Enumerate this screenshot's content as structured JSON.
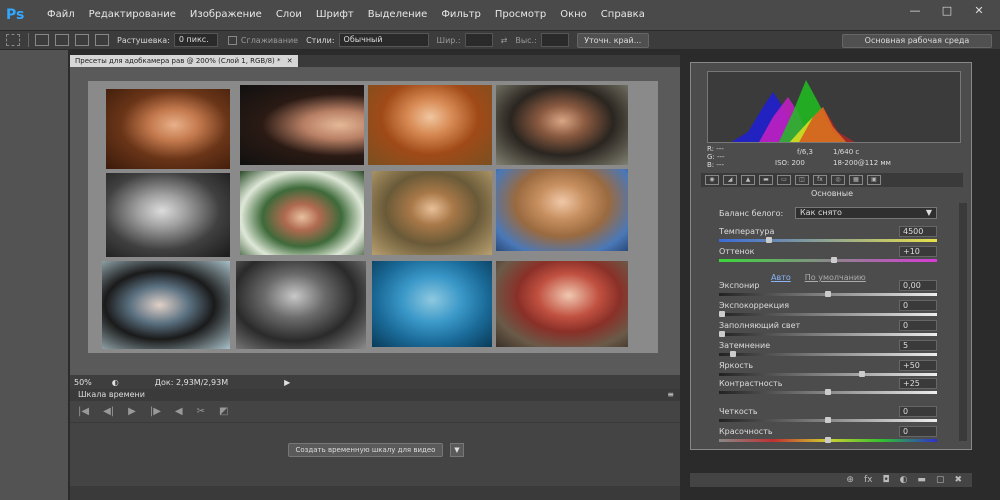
{
  "app_logo": "Ps",
  "menu": [
    "Файл",
    "Редактирование",
    "Изображение",
    "Слои",
    "Шрифт",
    "Выделение",
    "Фильтр",
    "Просмотр",
    "Окно",
    "Справка"
  ],
  "window_controls": [
    "—",
    "□",
    "✕"
  ],
  "options": {
    "feather_label": "Растушевка:",
    "feather_value": "0 пикс.",
    "antialias_label": "Сглаживание",
    "style_label": "Стили:",
    "style_value": "Обычный",
    "width_label": "Шир.:",
    "height_label": "Выс.:",
    "refine_btn": "Уточн. край...",
    "workspace": "Основная рабочая среда"
  },
  "document": {
    "tab_title": "Пресеты для адобкамера рав @ 200% (Слой 1, RGB/8) *",
    "zoom": "50%",
    "doc_info": "Док: 2,93M/2,93M"
  },
  "timeline": {
    "title": "Шкала времени",
    "create_btn": "Создать временную шкалу для видео"
  },
  "raw_panel": {
    "info_r": "R:  ---",
    "info_g": "G:  ---",
    "info_b": "B:  ---",
    "aperture": "f/6,3",
    "shutter": "1/640 с",
    "iso": "ISO: 200",
    "lens": "18-200@112 мм",
    "section": "Основные",
    "wb_label": "Баланс белого:",
    "wb_value": "Как снято",
    "link_auto": "Авто",
    "link_default": "По умолчанию",
    "sliders": [
      {
        "label": "Температура",
        "value": "4500",
        "pos": 0.22
      },
      {
        "label": "Оттенок",
        "value": "+10",
        "pos": 0.53
      },
      {
        "label": "Экспонир",
        "value": "0,00",
        "pos": 0.5
      },
      {
        "label": "Экспокоррекция",
        "value": "0",
        "pos": 0.0
      },
      {
        "label": "Заполняющий свет",
        "value": "0",
        "pos": 0.0
      },
      {
        "label": "Затемнение",
        "value": "5",
        "pos": 0.05
      },
      {
        "label": "Яркость",
        "value": "+50",
        "pos": 0.66
      },
      {
        "label": "Контрастность",
        "value": "+25",
        "pos": 0.5
      },
      {
        "label": "Четкость",
        "value": "0",
        "pos": 0.5
      },
      {
        "label": "Красочность",
        "value": "0",
        "pos": 0.5
      }
    ]
  },
  "colors": {
    "accent": "#31a8ff",
    "panel": "#4c4c4c",
    "canvas": "#5a5a5a"
  }
}
